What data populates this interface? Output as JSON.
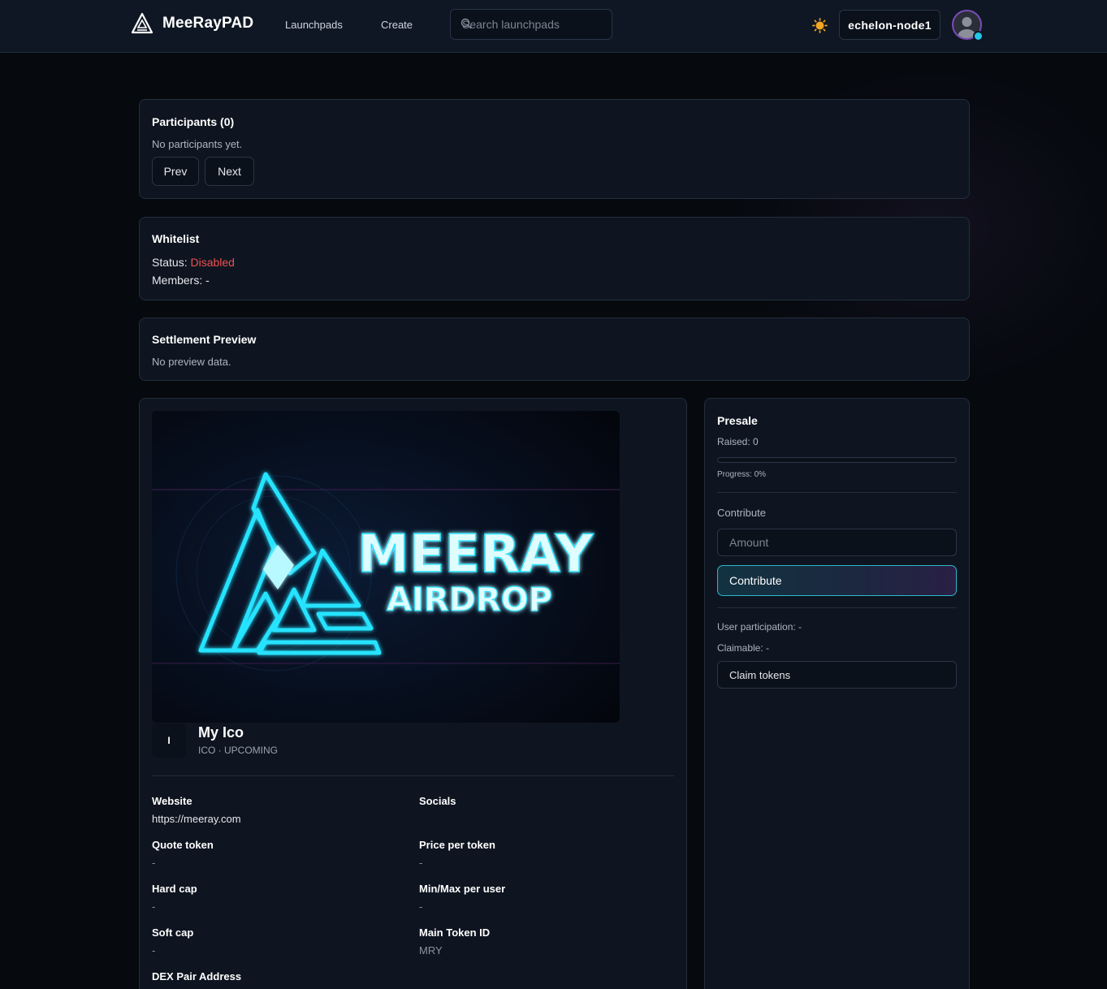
{
  "header": {
    "brand": "MeeRayPAD",
    "nav": [
      {
        "label": "Launchpads"
      },
      {
        "label": "Create"
      }
    ],
    "search": {
      "placeholder": "Search launchpads",
      "value": ""
    },
    "node_label": "echelon-node1",
    "icons": {
      "theme": "sun-icon",
      "search": "search-icon",
      "avatar": "user-avatar-icon"
    },
    "accent_color": "#22c7e6"
  },
  "participants": {
    "title": "Participants (0)",
    "empty_text": "No participants yet.",
    "prev_label": "Prev",
    "next_label": "Next"
  },
  "whitelist": {
    "title": "Whitelist",
    "status_label": "Status:",
    "status_value": "Disabled",
    "status_color": "#ef5050",
    "members_label": "Members:",
    "members_value": "-"
  },
  "settlement": {
    "title": "Settlement Preview",
    "empty_text": "No preview data."
  },
  "project": {
    "banner": {
      "headline": "MEERAY",
      "subline": "AIRDROP"
    },
    "badge_letter": "I",
    "name": "My Ico",
    "subtitle": "ICO · UPCOMING",
    "fields": [
      {
        "label": "Website",
        "value": "https://meeray.com"
      },
      {
        "label": "Socials",
        "value": ""
      },
      {
        "label": "Quote token",
        "value": "-"
      },
      {
        "label": "Price per token",
        "value": "-"
      },
      {
        "label": "Hard cap",
        "value": "-"
      },
      {
        "label": "Min/Max per user",
        "value": "-"
      },
      {
        "label": "Soft cap",
        "value": "-"
      },
      {
        "label": "Main Token ID",
        "value": "MRY"
      },
      {
        "label": "DEX Pair Address",
        "value": ""
      }
    ]
  },
  "presale": {
    "title": "Presale",
    "raised_text": "Raised: 0",
    "progress_fraction": 0,
    "progress_text": "Progress: 0%",
    "contribute_heading": "Contribute",
    "amount_placeholder": "Amount",
    "contribute_button": "Contribute",
    "user_participation_text": "User participation: -",
    "claimable_text": "Claimable: -",
    "claim_button": "Claim tokens"
  }
}
